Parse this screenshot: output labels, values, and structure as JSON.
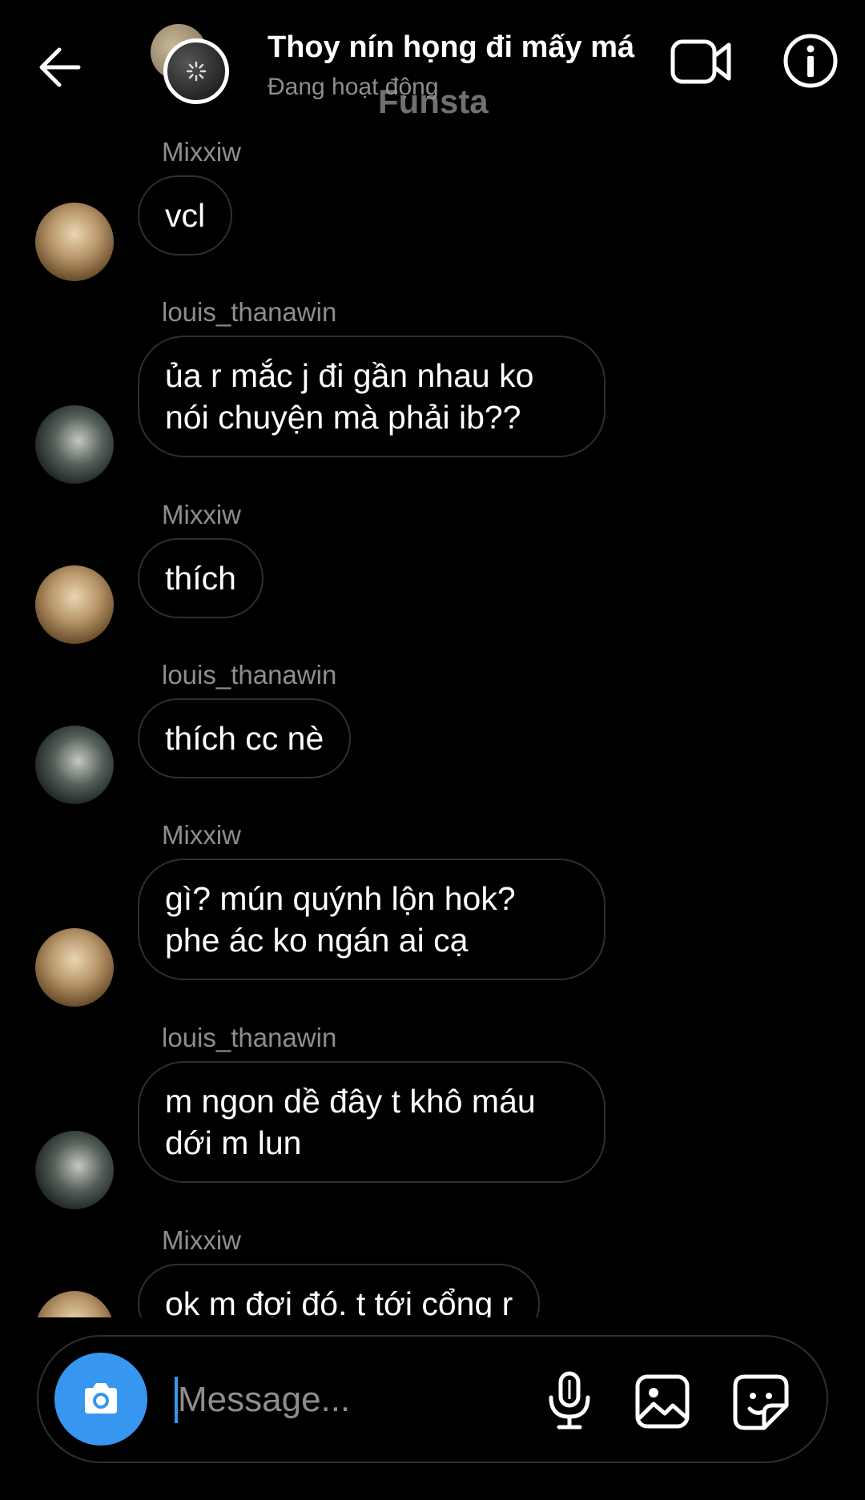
{
  "header": {
    "title": "Thoy nín họng đi mấy má",
    "status": "Đang hoạt động",
    "watermark": "Funsta"
  },
  "icons": {
    "back": "arrow-left-icon",
    "video": "video-camera-icon",
    "info": "info-icon",
    "camera": "camera-icon",
    "mic": "microphone-icon",
    "gallery": "image-icon",
    "sticker": "sticker-icon"
  },
  "colors": {
    "accent": "#3797f0",
    "background": "#000000",
    "bubble_border": "#2f2f2f",
    "muted_text": "#8e8e8e"
  },
  "messages": [
    {
      "sender": "Mixxiw",
      "text": "vcl"
    },
    {
      "sender": "louis_thanawin",
      "text": "ủa r mắc j đi gần nhau ko\nnói chuyện mà phải ib??"
    },
    {
      "sender": "Mixxiw",
      "text": "thích"
    },
    {
      "sender": "louis_thanawin",
      "text": "thích cc nè"
    },
    {
      "sender": "Mixxiw",
      "text": "gì? mún quýnh lộn hok?\nphe ác ko ngán ai cạ"
    },
    {
      "sender": "louis_thanawin",
      "text": "m ngon dề đây t khô máu\ndới m lun"
    },
    {
      "sender": "Mixxiw",
      "text": "ok m đợi đó. t tới cổng r"
    }
  ],
  "composer": {
    "placeholder": "Message..."
  }
}
